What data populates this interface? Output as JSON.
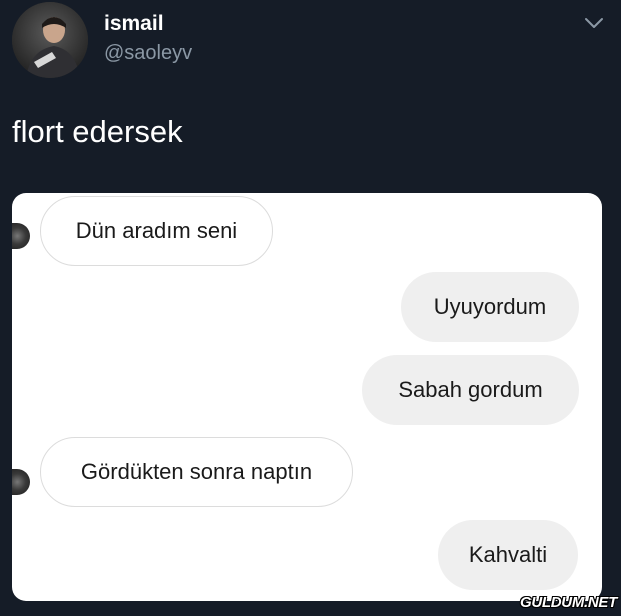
{
  "tweet": {
    "display_name": "ismail",
    "handle": "@saoleyv",
    "text": "flort edersek",
    "menu_icon": "chevron-down-icon"
  },
  "chat": {
    "messages": [
      {
        "side": "incoming",
        "text": "Dün aradım seni"
      },
      {
        "side": "outgoing",
        "text": "Uyuyordum"
      },
      {
        "side": "outgoing",
        "text": "Sabah gordum"
      },
      {
        "side": "incoming",
        "text": "Gördükten sonra naptın"
      },
      {
        "side": "outgoing",
        "text": "Kahvalti"
      }
    ]
  },
  "watermark": "GULDUM.NET",
  "colors": {
    "background": "#151c27",
    "handle": "#8b98a5",
    "outgoing_bubble": "#efefef",
    "incoming_border": "#dcdcdc"
  }
}
